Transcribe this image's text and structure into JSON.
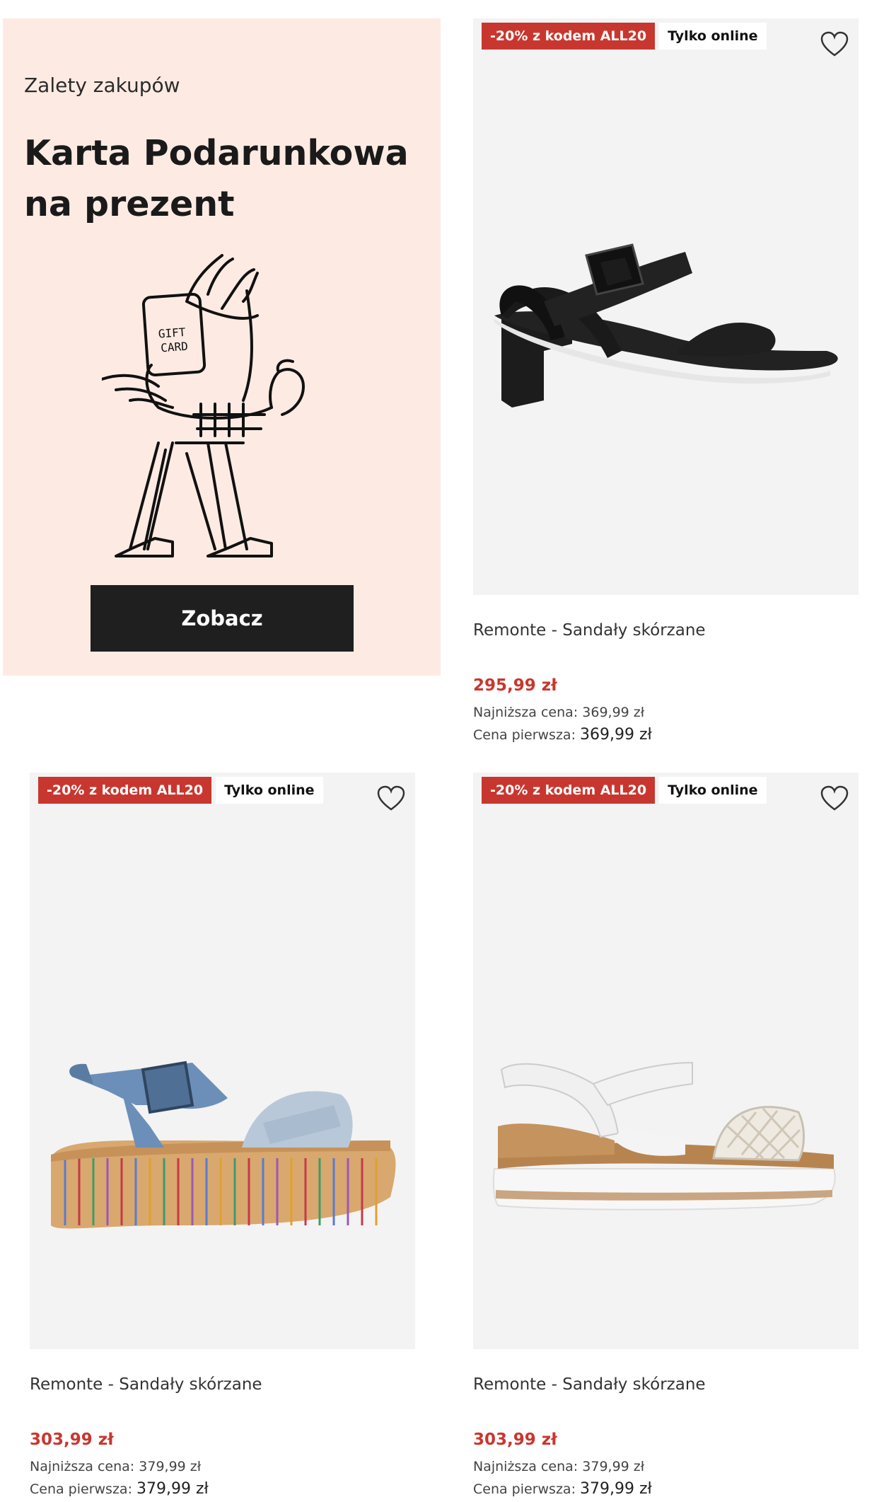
{
  "promo": {
    "eyebrow": "Zalety zakupów",
    "title_line1": "Karta Podarunkowa",
    "title_line2": "na prezent",
    "illustration_text_1": "GIFT",
    "illustration_text_2": "CARD",
    "button_label": "Zobacz",
    "background": "#fdebe3"
  },
  "products": [
    {
      "badge_promo": "-20% z kodem ALL20",
      "badge_online": "Tylko online",
      "name": "Remonte - Sandały skórzane",
      "price": "295,99 zł",
      "lowest_label": "Najniższa cena:",
      "lowest_value": "369,99 zł",
      "first_label": "Cena pierwsza:",
      "first_value": "369,99 zł",
      "image_icon": "black-heeled-sandal"
    },
    {
      "badge_promo": "-20% z kodem ALL20",
      "badge_online": "Tylko online",
      "name": "Remonte - Sandały skórzane",
      "price": "303,99 zł",
      "lowest_label": "Najniższa cena:",
      "lowest_value": "379,99 zł",
      "first_label": "Cena pierwsza:",
      "first_value": "379,99 zł",
      "image_icon": "blue-wedge-sandal"
    },
    {
      "badge_promo": "-20% z kodem ALL20",
      "badge_online": "Tylko online",
      "name": "Remonte - Sandały skórzane",
      "price": "303,99 zł",
      "lowest_label": "Najniższa cena:",
      "lowest_value": "379,99 zł",
      "first_label": "Cena pierwsza:",
      "first_value": "379,99 zł",
      "image_icon": "white-wedge-sandal"
    }
  ],
  "colors": {
    "accent_red": "#c8372f",
    "button_dark": "#1f1f1f",
    "image_bg": "#f3f3f3"
  }
}
